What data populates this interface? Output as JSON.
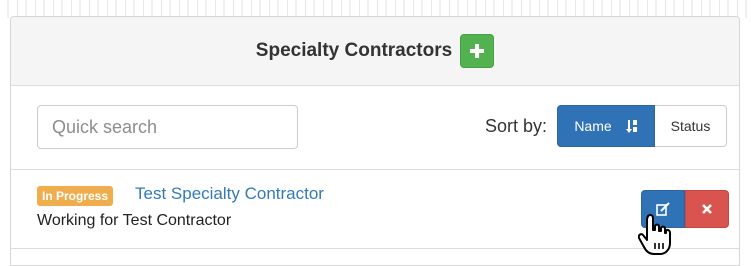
{
  "header": {
    "title": "Specialty Contractors",
    "add_icon": "plus-icon",
    "add_color": "#53b250"
  },
  "search": {
    "placeholder": "Quick search",
    "value": ""
  },
  "sort": {
    "label": "Sort by:",
    "options": [
      {
        "label": "Name",
        "active": true,
        "icon": "sort-alpha-icon"
      },
      {
        "label": "Status",
        "active": false
      }
    ],
    "active_color": "#2f72b6"
  },
  "contractors": [
    {
      "status": "In Progress",
      "status_color": "#efad4d",
      "name": "Test Specialty Contractor",
      "subtitle": "Working for Test Contractor",
      "edit_icon": "edit-icon",
      "delete_icon": "close-icon"
    }
  ],
  "colors": {
    "link": "#337ab7",
    "danger": "#d9534f"
  }
}
